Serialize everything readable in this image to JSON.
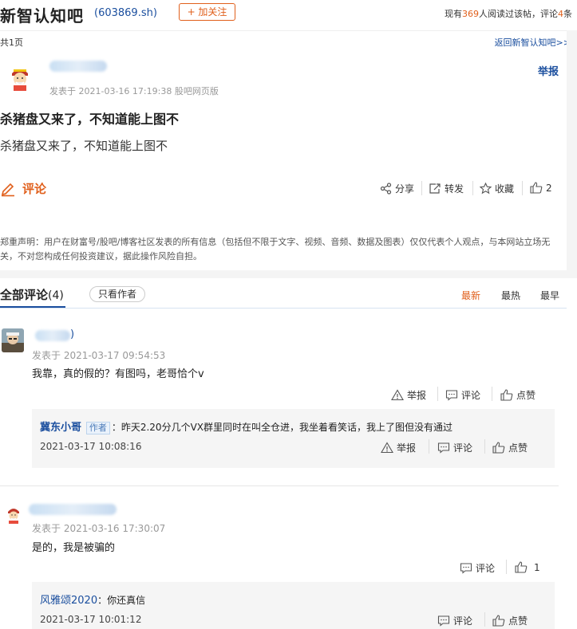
{
  "header": {
    "title": "新智认知吧",
    "code": "(603869.sh)",
    "follow_label": "+ 加关注",
    "stats_prefix": "现有",
    "readers": "369",
    "stats_mid": "人阅读过该帖，评论",
    "comments": "4",
    "stats_suffix": "条"
  },
  "subheader": {
    "pages": "共1页",
    "back_link": "返回新智认知吧>>"
  },
  "post": {
    "time_source": "发表于 2021-03-16 17:19:38 股吧网页版",
    "report_label": "举报",
    "title": "杀猪盘又来了，不知道能上图不",
    "body": "杀猪盘又来了，不知道能上图不",
    "comment_label": "评论",
    "share_label": "分享",
    "forward_label": "转发",
    "collect_label": "收藏",
    "like_count": "2"
  },
  "disclaimer": "郑重声明：用户在财富号/股吧/博客社区发表的所有信息（包括但不限于文字、视频、音频、数据及图表）仅仅代表个人观点，与本网站立场无关，不对您构成任何投资建议，据此操作风险自担。",
  "comments_section": {
    "title": "全部评论",
    "count": "(4)",
    "author_only": "只看作者",
    "sort": [
      "最新",
      "最热",
      "最早"
    ],
    "sort_active_color": "#e05f1b"
  },
  "comments": [
    {
      "time": "发表于 2021-03-17 09:54:53",
      "name_tail": ")",
      "text": "我靠，真的假的？有图吗，老哥恰个v",
      "report": "举报",
      "reply": "评论",
      "like": "点赞",
      "reply_item": {
        "user": "冀东小哥",
        "badge": "作者",
        "text": "：昨天2.20分几个VX群里同时在叫全仓进，我坐着看笑话，我上了图但没有通过",
        "time": "2021-03-17 10:08:16",
        "report": "举报",
        "reply": "评论",
        "like": "点赞"
      }
    },
    {
      "time": "发表于 2021-03-16 17:30:07",
      "text": "是的，我是被骗的",
      "reply": "评论",
      "like_count": "1",
      "reply_item": {
        "user": "风雅颂2020",
        "text": "：你还真信",
        "time": "2021-03-17 10:01:12",
        "reply": "评论",
        "like": "点赞"
      }
    }
  ],
  "icons": [
    "pencil-icon",
    "share-icon",
    "forward-icon",
    "star-icon",
    "thumbs-up-icon",
    "warning-icon",
    "comment-icon"
  ]
}
